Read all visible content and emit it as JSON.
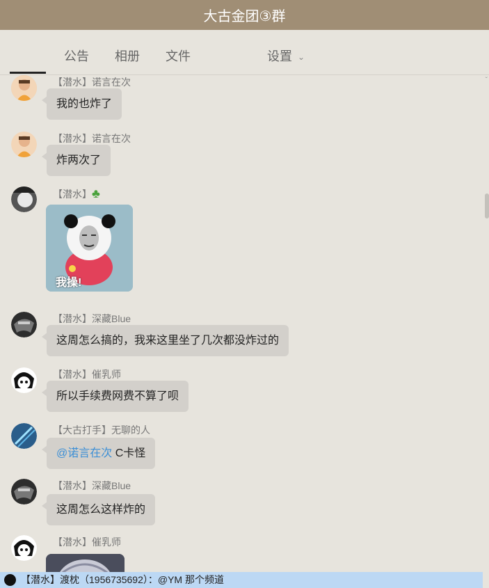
{
  "window": {
    "title": "大古金团③群"
  },
  "tabs": [
    {
      "label": "公告"
    },
    {
      "label": "相册"
    },
    {
      "label": "文件"
    },
    {
      "label": "设置"
    }
  ],
  "messages": [
    {
      "sender": "【潜水】诺言在次",
      "text": "我的也炸了"
    },
    {
      "sender": "【潜水】诺言在次",
      "text": "炸两次了"
    },
    {
      "sender": "【潜水】",
      "sender_icon": "four-leaf-clover",
      "sticker_text": "我操!"
    },
    {
      "sender": "【潜水】深藏Blue",
      "text": "这周怎么搞的，我来这里坐了几次都没炸过的"
    },
    {
      "sender": "【潜水】催乳师",
      "text": "所以手续费网费不算了呗"
    },
    {
      "sender": "【大古打手】无聊的人",
      "mention": "@诺言在次",
      "text": "C卡怪"
    },
    {
      "sender": "【潜水】深藏Blue",
      "text": "这周怎么这样炸的"
    },
    {
      "sender": "【潜水】催乳师"
    }
  ],
  "notice": {
    "text": "【潜水】渡枕（1956735692）：@YM 那个频道"
  },
  "colors": {
    "titlebar": "#a08e75",
    "background": "#e7e4dd",
    "bubble": "#d3d0cb",
    "mention": "#3c8fd6",
    "notice": "#bcd8f4"
  }
}
